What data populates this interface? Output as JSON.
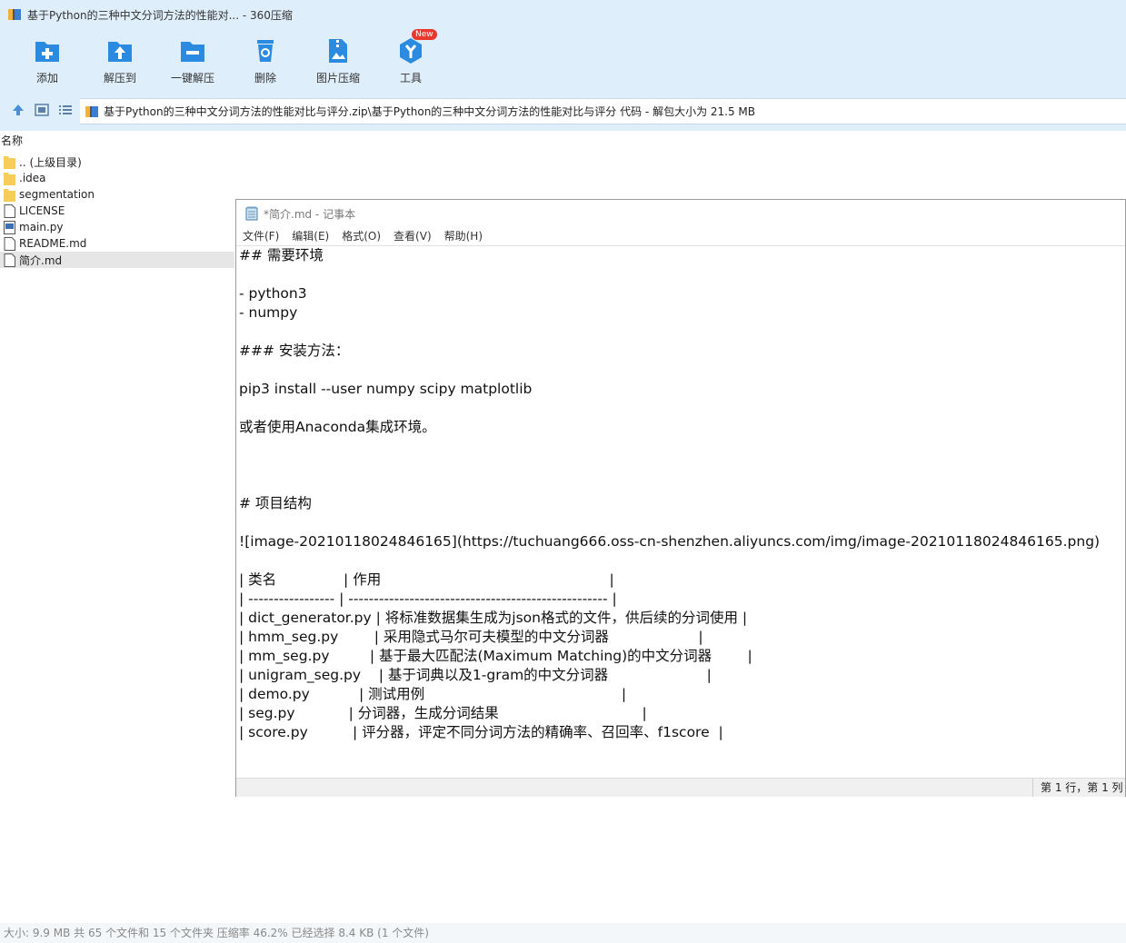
{
  "window": {
    "title": "基于Python的三种中文分词方法的性能对... - 360压缩"
  },
  "toolbar": {
    "items": [
      {
        "label": "添加",
        "icon": "add-file-icon"
      },
      {
        "label": "解压到",
        "icon": "extract-to-icon"
      },
      {
        "label": "一键解压",
        "icon": "one-click-extract-icon"
      },
      {
        "label": "删除",
        "icon": "delete-icon"
      },
      {
        "label": "图片压缩",
        "icon": "image-compress-icon"
      },
      {
        "label": "工具",
        "icon": "tools-icon",
        "badge": "New"
      }
    ],
    "accent_color": "#2a8be0"
  },
  "address": {
    "path": "基于Python的三种中文分词方法的性能对比与评分.zip\\基于Python的三种中文分词方法的性能对比与评分 代码 - 解包大小为 21.5 MB"
  },
  "file_list": {
    "header": "名称",
    "items": [
      {
        "name": ".. (上级目录)",
        "type": "folder"
      },
      {
        "name": ".idea",
        "type": "folder"
      },
      {
        "name": "segmentation",
        "type": "folder"
      },
      {
        "name": "LICENSE",
        "type": "file"
      },
      {
        "name": "main.py",
        "type": "python"
      },
      {
        "name": "README.md",
        "type": "file"
      },
      {
        "name": "简介.md",
        "type": "file",
        "selected": true
      }
    ]
  },
  "status": {
    "text": "大小: 9.9 MB 共 65 个文件和 15 个文件夹 压缩率 46.2% 已经选择 8.4 KB (1 个文件)"
  },
  "notepad": {
    "title": "*简介.md - 记事本",
    "menu": [
      "文件(F)",
      "编辑(E)",
      "格式(O)",
      "查看(V)",
      "帮助(H)"
    ],
    "lines": [
      "## 需要环境",
      "",
      "- python3",
      "- numpy",
      "",
      "### 安装方法：",
      "",
      "pip3 install --user numpy scipy matplotlib",
      "",
      "或者使用Anaconda集成环境。",
      "",
      "",
      "",
      "# 项目结构",
      "",
      "![image-20210118024846165](https://tuchuang666.oss-cn-shenzhen.aliyuncs.com/img/image-20210118024846165.png)",
      "",
      "| 类名               | 作用                                                   |",
      "| ----------------- | --------------------------------------------------- |",
      "| dict_generator.py | 将标准数据集生成为json格式的文件，供后续的分词使用 |",
      "| hmm_seg.py        | 采用隐式马尔可夫模型的中文分词器                    |",
      "| mm_seg.py         | 基于最大匹配法(Maximum Matching)的中文分词器        |",
      "| unigram_seg.py    | 基于词典以及1-gram的中文分词器                      |",
      "| demo.py           | 测试用例                                            |",
      "| seg.py            | 分词器，生成分词结果                                |",
      "| score.py          | 评分器，评定不同分词方法的精确率、召回率、f1score  |"
    ],
    "status": "第 1 行，第 1 列"
  }
}
